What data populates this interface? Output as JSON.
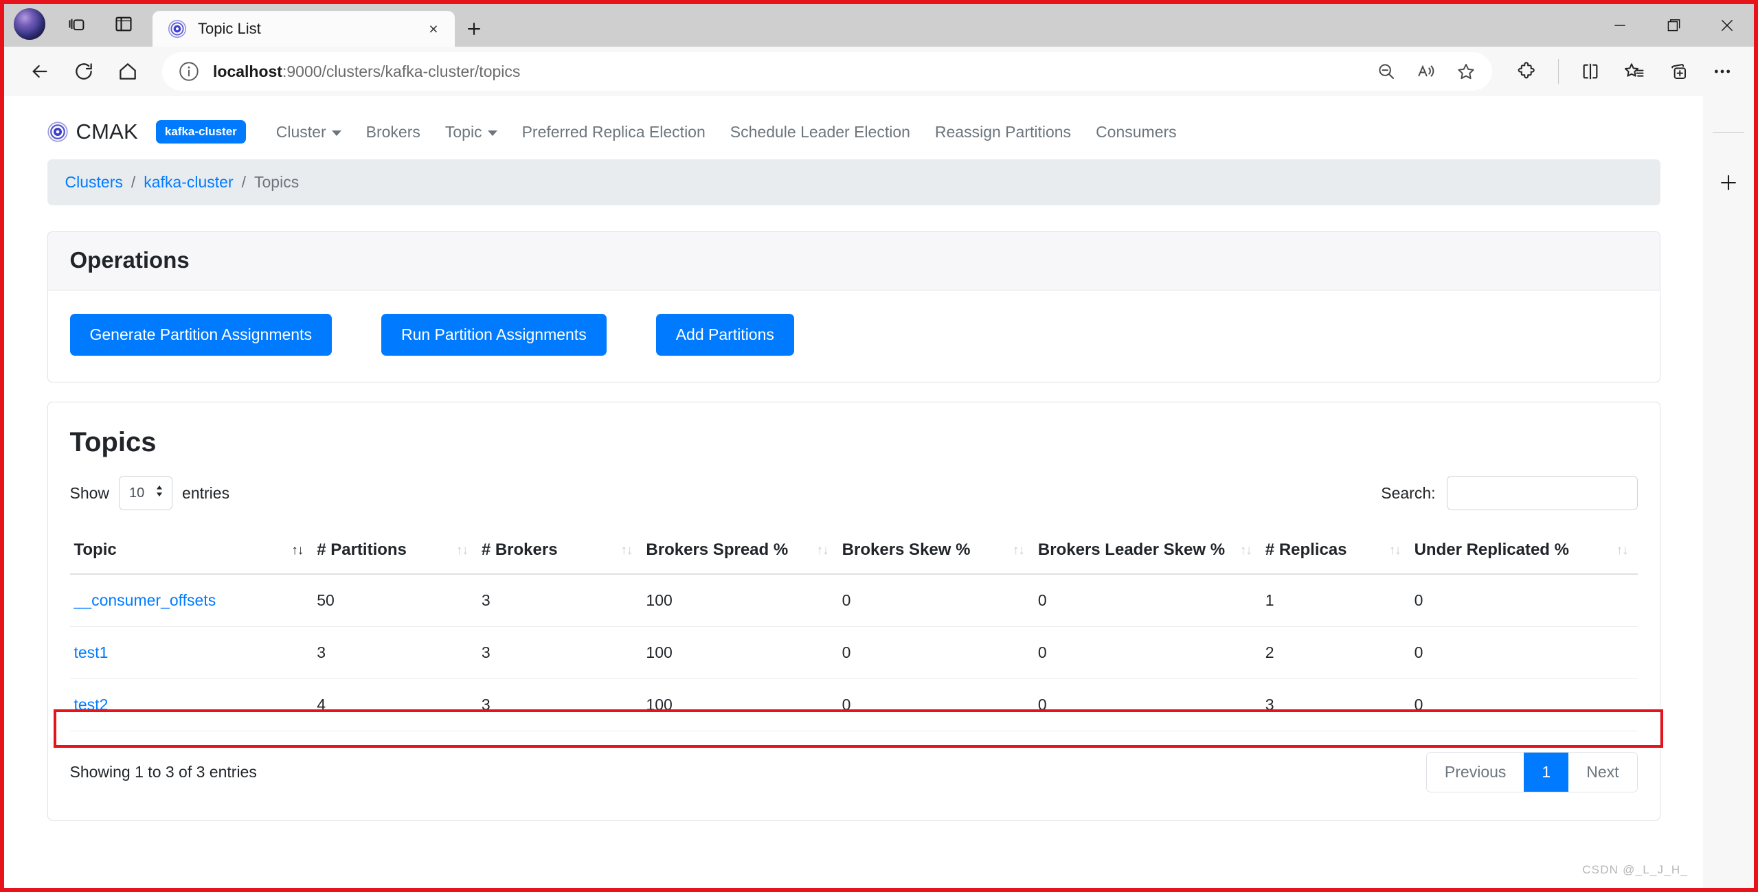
{
  "browser": {
    "tab": {
      "title": "Topic List",
      "favicon_name": "cmak-favicon",
      "close_label": "×"
    },
    "new_tab_label": "+",
    "left_icons": [
      {
        "name": "profile-avatar",
        "label": ""
      },
      {
        "name": "tab-actions-icon",
        "label": ""
      },
      {
        "name": "split-pane-icon",
        "label": ""
      }
    ],
    "window_controls": {
      "minimize": "—",
      "maximize": "❐",
      "close": "✕"
    },
    "toolbar": {
      "back_label": "←",
      "refresh_label": "↻",
      "home_label": "⌂",
      "url_prefix": "localhost",
      "url_rest": ":9000/clusters/kafka-cluster/topics",
      "url_full": "localhost:9000/clusters/kafka-cluster/topics",
      "info_icon": "info-icon",
      "actions": [
        "zoom-out-icon",
        "read-aloud-icon",
        "favorite-star-icon",
        "extensions-puzzle-icon",
        "split-screen-icon",
        "collections-icon",
        "add-tab-group-icon",
        "settings-ellipsis-icon"
      ]
    },
    "rail": {
      "add_label": "+"
    }
  },
  "app": {
    "brand": "CMAK",
    "cluster_badge": "kafka-cluster",
    "nav": [
      {
        "label": "Cluster",
        "has_caret": true
      },
      {
        "label": "Brokers",
        "has_caret": false
      },
      {
        "label": "Topic",
        "has_caret": true
      },
      {
        "label": "Preferred Replica Election",
        "has_caret": false
      },
      {
        "label": "Schedule Leader Election",
        "has_caret": false
      },
      {
        "label": "Reassign Partitions",
        "has_caret": false
      },
      {
        "label": "Consumers",
        "has_caret": false
      }
    ],
    "breadcrumb": [
      {
        "label": "Clusters",
        "link": true
      },
      {
        "label": "/",
        "sep": true
      },
      {
        "label": "kafka-cluster",
        "link": true
      },
      {
        "label": "/",
        "sep": true
      },
      {
        "label": "Topics",
        "link": false
      }
    ],
    "operations": {
      "title": "Operations",
      "buttons": [
        "Generate Partition Assignments",
        "Run Partition Assignments",
        "Add Partitions"
      ]
    },
    "topics": {
      "title": "Topics",
      "show_label": "Show",
      "entries_label": "entries",
      "page_length": "10",
      "search_label": "Search:",
      "search_value": "",
      "search_placeholder": "",
      "columns": [
        "Topic",
        "# Partitions",
        "# Brokers",
        "Brokers Spread %",
        "Brokers Skew %",
        "Brokers Leader Skew %",
        "# Replicas",
        "Under Replicated %"
      ],
      "rows": [
        {
          "topic": "__consumer_offsets",
          "partitions": "50",
          "brokers": "3",
          "brokers_spread": "100",
          "brokers_skew": "0",
          "brokers_leader_skew": "0",
          "replicas": "1",
          "under_replicated": "0"
        },
        {
          "topic": "test1",
          "partitions": "3",
          "brokers": "3",
          "brokers_spread": "100",
          "brokers_skew": "0",
          "brokers_leader_skew": "0",
          "replicas": "2",
          "under_replicated": "0"
        },
        {
          "topic": "test2",
          "partitions": "4",
          "brokers": "3",
          "brokers_spread": "100",
          "brokers_skew": "0",
          "brokers_leader_skew": "0",
          "replicas": "3",
          "under_replicated": "0"
        }
      ],
      "info": "Showing 1 to 3 of 3 entries",
      "pagination": {
        "previous": "Previous",
        "pages": [
          "1"
        ],
        "active_page": "1",
        "next": "Next"
      }
    }
  },
  "colors": {
    "accent": "#007bff",
    "annotation": "#e8121b",
    "breadcrumb_bg": "#e9ecef",
    "muted_text": "#6c757d"
  },
  "watermark": "CSDN @_L_J_H_"
}
